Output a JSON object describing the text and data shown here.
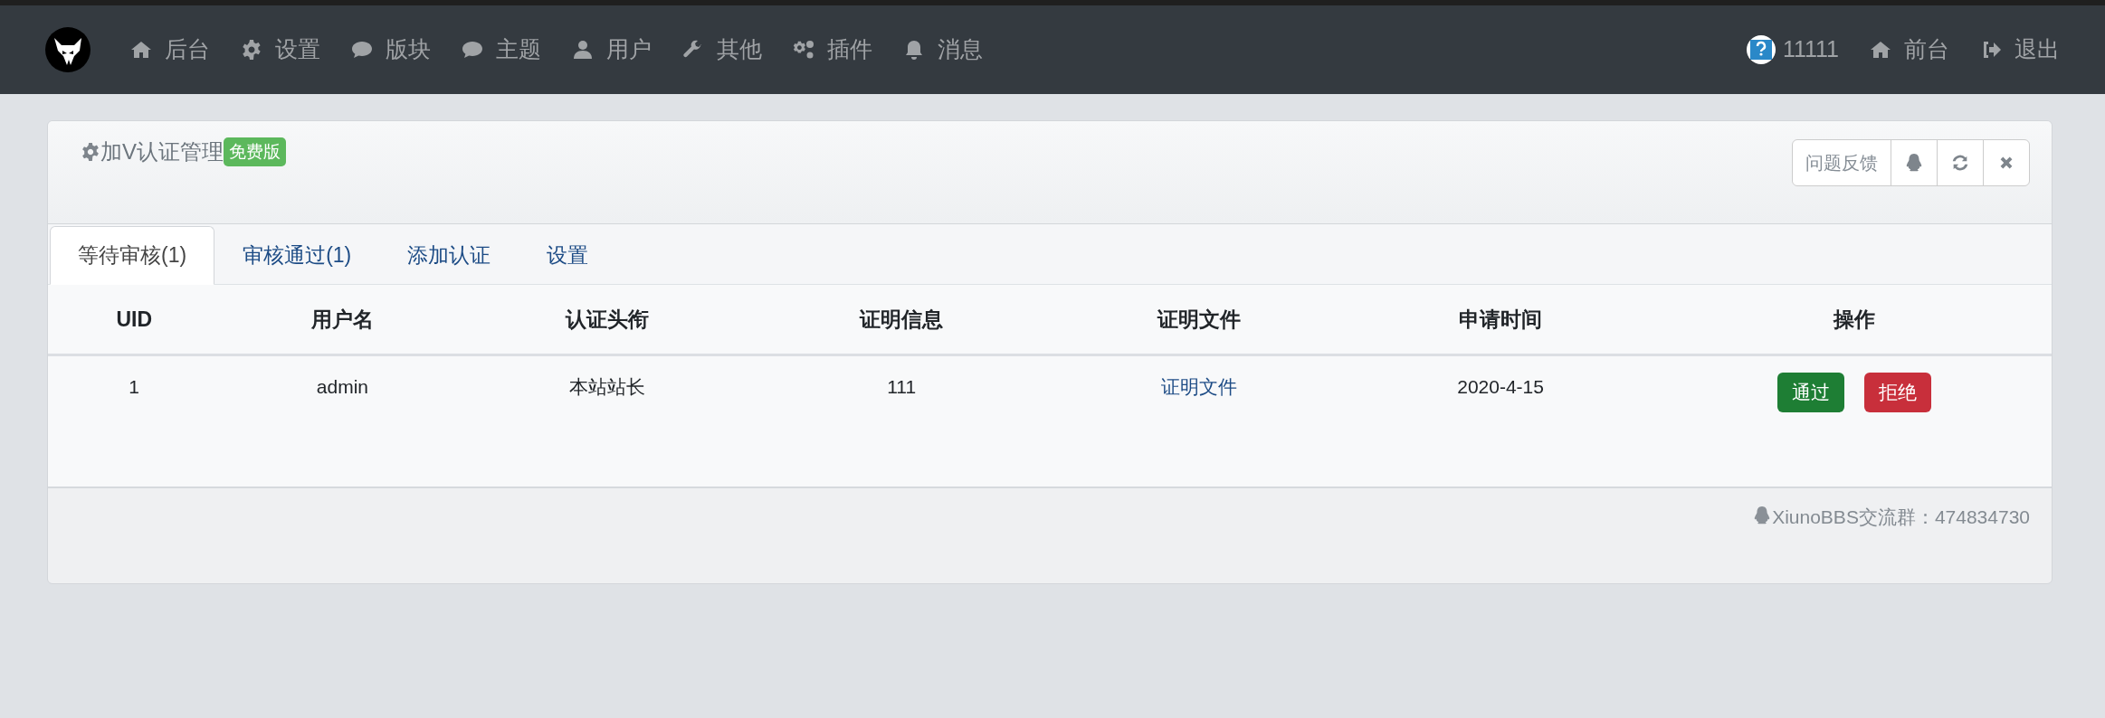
{
  "navbar": {
    "menu": [
      {
        "label": "后台"
      },
      {
        "label": "设置"
      },
      {
        "label": "版块"
      },
      {
        "label": "主题"
      },
      {
        "label": "用户"
      },
      {
        "label": "其他"
      },
      {
        "label": "插件"
      },
      {
        "label": "消息"
      }
    ],
    "user": {
      "name": "11111"
    },
    "right_links": [
      {
        "label": "前台"
      },
      {
        "label": "退出"
      }
    ]
  },
  "panel": {
    "title": "加V认证管理",
    "badge": "免费版",
    "tools": [
      {
        "kind": "text",
        "label": "问题反馈"
      },
      {
        "kind": "qq"
      },
      {
        "kind": "refresh"
      },
      {
        "kind": "close"
      }
    ],
    "tabs": [
      {
        "label": "等待审核(1)",
        "selected": true
      },
      {
        "label": "审核通过(1)",
        "selected": false
      },
      {
        "label": "添加认证",
        "selected": false
      },
      {
        "label": "设置",
        "selected": false
      }
    ],
    "table": {
      "columns": [
        "UID",
        "用户名",
        "认证头衔",
        "证明信息",
        "证明文件",
        "申请时间",
        "操作"
      ],
      "rows": [
        {
          "uid": "1",
          "username": "admin",
          "title": "本站站长",
          "info": "111",
          "file": "证明文件",
          "date": "2020-4-15",
          "actions": [
            {
              "kind": "approve",
              "label": "通过"
            },
            {
              "kind": "reject",
              "label": "拒绝"
            }
          ]
        }
      ]
    },
    "footer": "XiunoBBS交流群：474834730"
  }
}
